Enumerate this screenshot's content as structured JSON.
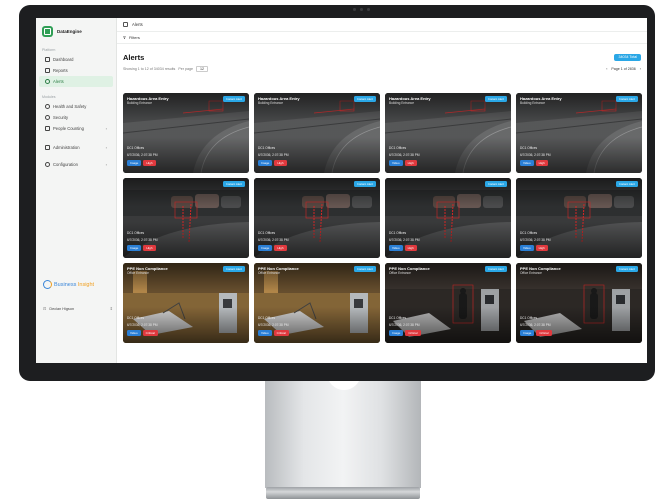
{
  "brand": {
    "name": "DataEngine"
  },
  "sidebar": {
    "section_platform": "Platform",
    "platform_items": [
      {
        "label": "Dashboard",
        "icon": "grid-icon"
      },
      {
        "label": "Reports",
        "icon": "chart-icon"
      },
      {
        "label": "Alerts",
        "icon": "alert-icon",
        "active": true
      }
    ],
    "section_modules": "Modules",
    "module_items": [
      {
        "label": "Health and Safety",
        "icon": "shield-icon"
      },
      {
        "label": "Security",
        "icon": "lock-icon"
      },
      {
        "label": "People Counting",
        "icon": "people-icon"
      }
    ],
    "admin_items": [
      {
        "label": "Administration",
        "icon": "admin-icon"
      },
      {
        "label": "Configuration",
        "icon": "gear-icon"
      }
    ],
    "bi_logo": {
      "word1": "Business",
      "word2": "Insight"
    },
    "user": {
      "name": "Declan Higson"
    }
  },
  "topbar": {
    "title": "Alerts"
  },
  "filters": {
    "label": "Filters"
  },
  "main": {
    "title": "Alerts",
    "total_button": "34034 Total",
    "showing": "Showing 1 to 12 of 34034 results",
    "per_page_label": "Per page",
    "per_page_value": "12",
    "pager": "Page 1 of 2836",
    "prev": "‹",
    "next": "›"
  },
  "cards": [
    {
      "title": "Hazardous Area Entry",
      "sub": "Building Entrance",
      "badge": "Instant Alert",
      "site": "DC1 Offices",
      "time": "6/7/2036, 2:07:38 PM",
      "tag1": "Image",
      "tag2": "High",
      "scene": "road"
    },
    {
      "title": "Hazardous Area Entry",
      "sub": "Building Entrance",
      "badge": "Instant Alert",
      "site": "DC1 Offices",
      "time": "6/7/2036, 2:07:38 PM",
      "tag1": "Image",
      "tag2": "High",
      "scene": "road"
    },
    {
      "title": "Hazardous Area Entry",
      "sub": "Building Entrance",
      "badge": "Instant Alert",
      "site": "DC1 Offices",
      "time": "6/7/2036, 2:07:38 PM",
      "tag1": "Video",
      "tag2": "High",
      "scene": "road"
    },
    {
      "title": "Hazardous Area Entry",
      "sub": "Building Entrance",
      "badge": "Instant Alert",
      "site": "DC1 Offices",
      "time": "6/7/2036, 2:07:38 PM",
      "tag1": "Video",
      "tag2": "High",
      "scene": "road"
    },
    {
      "title": "",
      "sub": "",
      "badge": "Instant Alert",
      "site": "DC1 Offices",
      "time": "6/7/2036, 2:07:38 PM",
      "tag1": "Image",
      "tag2": "High",
      "scene": "cars"
    },
    {
      "title": "",
      "sub": "",
      "badge": "Instant Alert",
      "site": "DC1 Offices",
      "time": "6/7/2036, 2:07:38 PM",
      "tag1": "Image",
      "tag2": "High",
      "scene": "cars"
    },
    {
      "title": "",
      "sub": "",
      "badge": "Instant Alert",
      "site": "DC1 Offices",
      "time": "6/7/2036, 2:07:38 PM",
      "tag1": "Video",
      "tag2": "High",
      "scene": "cars"
    },
    {
      "title": "",
      "sub": "",
      "badge": "Instant Alert",
      "site": "DC1 Offices",
      "time": "6/7/2036, 2:07:38 PM",
      "tag1": "Video",
      "tag2": "High",
      "scene": "cars"
    },
    {
      "title": "PPE Non Compliance",
      "sub": "Office Entrance",
      "badge": "Instant Alert",
      "site": "DC1 Offices",
      "time": "6/7/2036, 2:07:38 PM",
      "tag1": "Video",
      "tag2": "Critical",
      "scene": "office"
    },
    {
      "title": "PPE Non Compliance",
      "sub": "Office Entrance",
      "badge": "Instant Alert",
      "site": "DC1 Offices",
      "time": "6/7/2036, 2:07:38 PM",
      "tag1": "Video",
      "tag2": "Critical",
      "scene": "office"
    },
    {
      "title": "PPE Non Compliance",
      "sub": "Office Entrance",
      "badge": "Instant Alert",
      "site": "DC1 Offices",
      "time": "6/7/2036, 2:07:38 PM",
      "tag1": "Image",
      "tag2": "Critical",
      "scene": "office-dark"
    },
    {
      "title": "PPE Non Compliance",
      "sub": "Office Entrance",
      "badge": "Instant Alert",
      "site": "DC1 Offices",
      "time": "6/7/2036, 2:07:38 PM",
      "tag1": "Image",
      "tag2": "Critical",
      "scene": "office-dark"
    }
  ],
  "colors": {
    "accent": "#2aa7e6",
    "brand": "#2f9e55",
    "critical": "#e0393e",
    "media": "#2a7fd6"
  }
}
